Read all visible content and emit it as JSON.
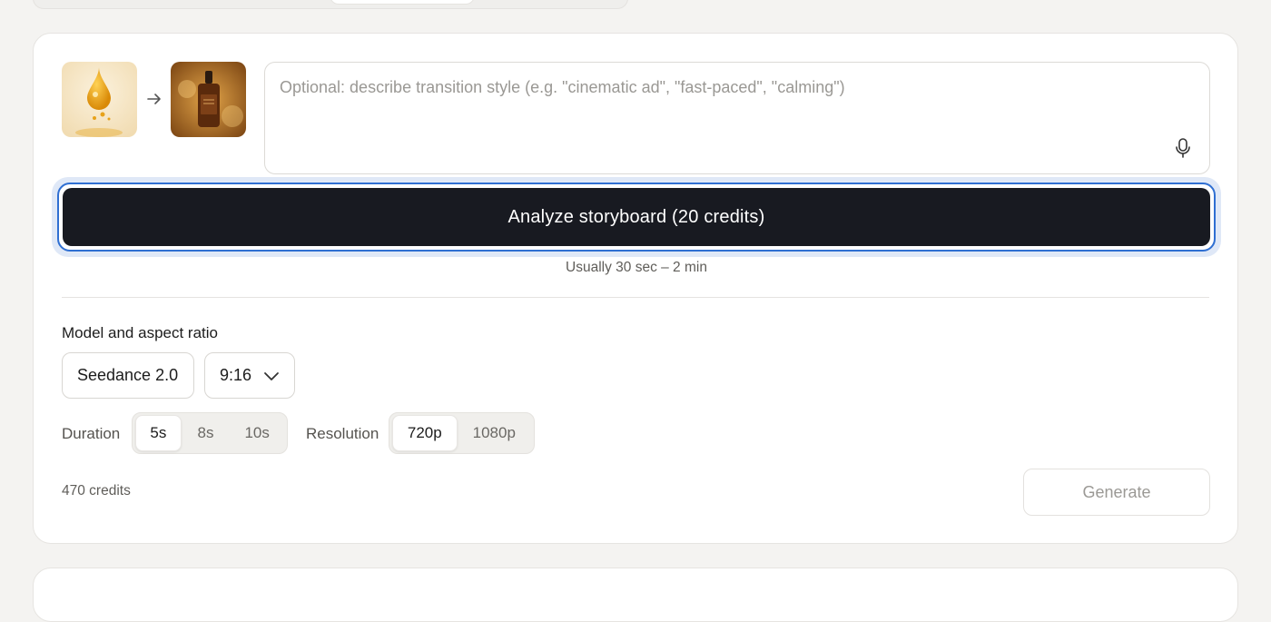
{
  "prompt": {
    "placeholder": "Optional: describe transition style (e.g. \"cinematic ad\", \"fast-paced\", \"calming\")"
  },
  "analyze": {
    "label": "Analyze storyboard (20 credits)",
    "hint": "Usually 30 sec – 2 min"
  },
  "model_section": {
    "label": "Model and aspect ratio",
    "model": "Seedance 2.0",
    "aspect_ratio": "9:16"
  },
  "duration": {
    "label": "Duration",
    "options": [
      "5s",
      "8s",
      "10s"
    ],
    "selected": "5s"
  },
  "resolution": {
    "label": "Resolution",
    "options": [
      "720p",
      "1080p"
    ],
    "selected": "720p"
  },
  "footer": {
    "credits": "470 credits",
    "generate_label": "Generate"
  },
  "colors": {
    "primary_button": "#181a21",
    "focus_ring": "#2f6fd2"
  }
}
